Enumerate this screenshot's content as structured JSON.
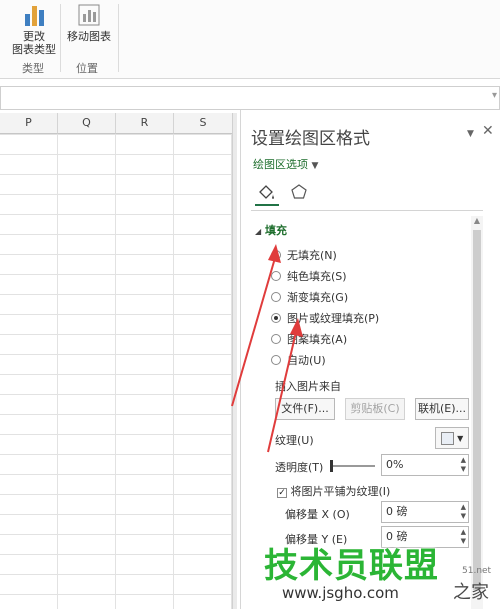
{
  "ribbon": {
    "change_chart_type": "更改\n图表类型",
    "move_chart": "移动图表",
    "group_type": "类型",
    "group_location": "位置"
  },
  "sheet": {
    "columns": [
      "P",
      "Q",
      "R",
      "S"
    ]
  },
  "panel": {
    "title": "设置绘图区格式",
    "options_label": "绘图区选项",
    "fill_section": "填充",
    "fill_options": [
      {
        "label": "无填充(N)",
        "selected": false
      },
      {
        "label": "纯色填充(S)",
        "selected": false
      },
      {
        "label": "渐变填充(G)",
        "selected": false
      },
      {
        "label": "图片或纹理填充(P)",
        "selected": true
      },
      {
        "label": "图案填充(A)",
        "selected": false
      },
      {
        "label": "自动(U)",
        "selected": false
      }
    ],
    "insert_picture_from": "插入图片来自",
    "file_button": "文件(F)...",
    "clipboard_button": "剪贴板(C)",
    "online_button": "联机(E)...",
    "texture_label": "纹理(U)",
    "transparency_label": "透明度(T)",
    "transparency_value": "0%",
    "tile_checkbox": "将图片平铺为纹理(I)",
    "tile_checked": true,
    "offset_x_label": "偏移量 X (O)",
    "offset_x_value": "0 磅",
    "offset_y_label": "偏移量 Y (E)",
    "offset_y_value": "0 磅"
  },
  "watermark": {
    "brand": "技术员联盟",
    "url": "www.jsgho.com",
    "partner_domain": "51.net",
    "partner_text": "之家"
  },
  "colors": {
    "accent_green": "#217346",
    "annotation_red": "#e03c3c",
    "watermark_green": "#2bb535"
  }
}
